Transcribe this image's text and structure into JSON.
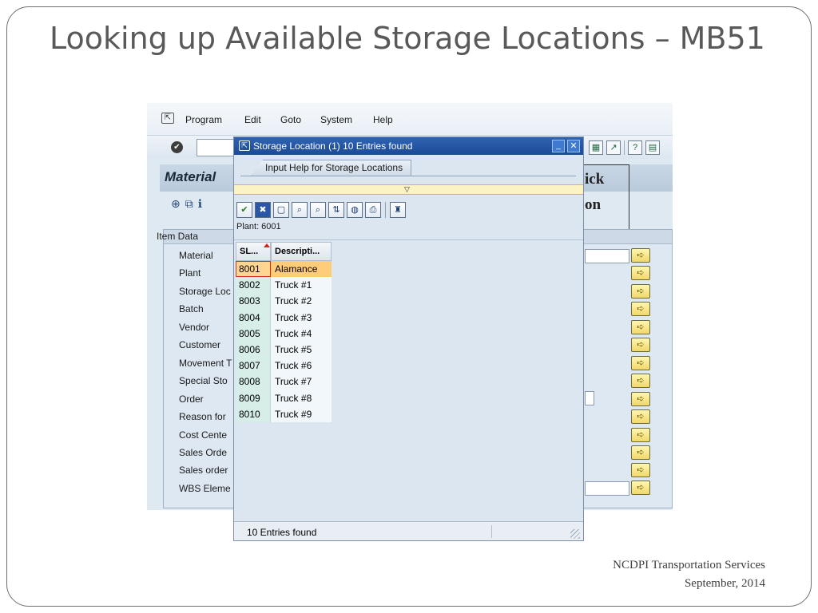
{
  "slide": {
    "title": "Looking up Available Storage Locations – MB51",
    "footer_line1": "NCDPI Transportation Services",
    "footer_line2": "September, 2014"
  },
  "menu": {
    "items": [
      {
        "label": "Program"
      },
      {
        "label": "Edit"
      },
      {
        "label": "Goto"
      },
      {
        "label": "System"
      },
      {
        "label": "Help"
      }
    ]
  },
  "screen": {
    "title_fragment": "Material",
    "callout_line1": "ick",
    "callout_line2": "on",
    "item_data_label": "Item Data",
    "fields": [
      "Material",
      "Plant",
      "Storage Loc",
      "Batch",
      "Vendor",
      "Customer",
      "Movement T",
      "Special Sto",
      "Order",
      "Reason for",
      "Cost Cente",
      "Sales Orde",
      "Sales order",
      "WBS Eleme"
    ]
  },
  "popup": {
    "title": "Storage Location (1)   10 Entries found",
    "tab_label": "Input Help for Storage Locations",
    "plant_label": "Plant: 6001",
    "col_headers": [
      "SL...",
      "Descripti..."
    ],
    "rows": [
      {
        "code": "8001",
        "desc": "Alamance",
        "selected": true
      },
      {
        "code": "8002",
        "desc": "Truck #1"
      },
      {
        "code": "8003",
        "desc": "Truck #2"
      },
      {
        "code": "8004",
        "desc": "Truck #3"
      },
      {
        "code": "8005",
        "desc": "Truck #4"
      },
      {
        "code": "8006",
        "desc": "Truck #5"
      },
      {
        "code": "8007",
        "desc": "Truck #6"
      },
      {
        "code": "8008",
        "desc": "Truck #7"
      },
      {
        "code": "8009",
        "desc": "Truck #8"
      },
      {
        "code": "8010",
        "desc": "Truck #9"
      }
    ],
    "status": "10 Entries found"
  },
  "colors": {
    "titlebar": "#1c4a97",
    "selected_row": "#ffcc7a",
    "selection_button": "#f1d86a"
  }
}
